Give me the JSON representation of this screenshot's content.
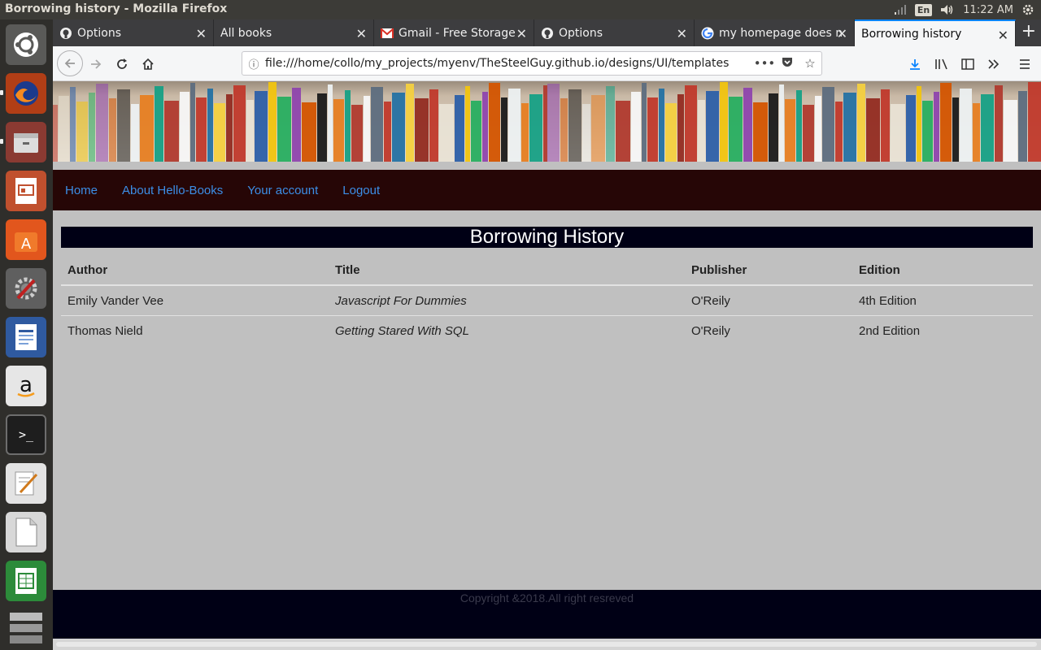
{
  "window": {
    "title": "Borrowing history - Mozilla Firefox"
  },
  "tray": {
    "keyboard": "En",
    "clock": "11:22 AM"
  },
  "tabs": [
    {
      "label": "Options",
      "icon": "github-icon"
    },
    {
      "label": "All books",
      "icon": ""
    },
    {
      "label": "Gmail - Free Storage",
      "icon": "gmail-icon"
    },
    {
      "label": "Options",
      "icon": "github-icon"
    },
    {
      "label": "my homepage does n",
      "icon": "google-icon"
    },
    {
      "label": "Borrowing history",
      "icon": "",
      "active": true
    }
  ],
  "navbar": {
    "url": "file:///home/collo/my_projects/myenv/TheSteelGuy.github.io/designs/UI/templates"
  },
  "site": {
    "nav": [
      "Home",
      "About Hello-Books",
      "Your account",
      "Logout"
    ],
    "heading": "Borrowing History",
    "table": {
      "headers": [
        "Author",
        "Title",
        "Publisher",
        "Edition"
      ],
      "rows": [
        [
          "Emily Vander Vee",
          "Javascript For Dummies",
          "O'Reily",
          "4th Edition"
        ],
        [
          "Thomas Nield",
          "Getting Stared With SQL",
          "O'Reily",
          "2nd Edition"
        ]
      ]
    },
    "footer": "Copyright &2018.All right resreved"
  },
  "colors": {
    "accent": "#0a84ff",
    "site_nav_bg": "#260606",
    "link": "#3c8ee6",
    "heading_bg": "#000015",
    "content_bg": "#c0c0c0"
  }
}
